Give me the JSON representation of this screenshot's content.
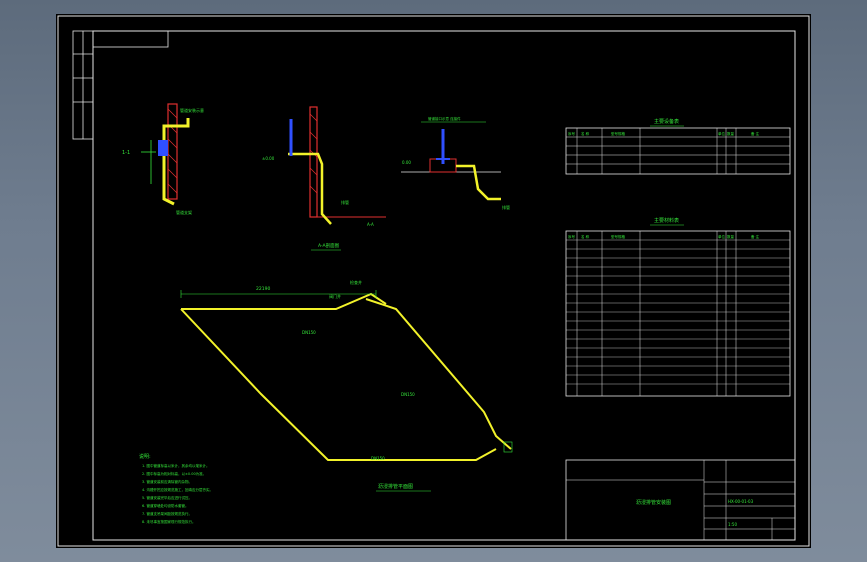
{
  "drawing": {
    "section_label": "1-1",
    "section_a_title": "A-A剖面图",
    "section_a_mark": "A-A",
    "plan_title": "沥浸排管平面图",
    "equipment_table_title": "主要设备表",
    "material_table_title": "主要材料表",
    "table_headers": [
      "序号",
      "名 称",
      "型号规格",
      "单位",
      "数量",
      "备 注"
    ],
    "notes_title": "说明:",
    "notes": [
      "1. 图中管道标高以米计，其余均以毫米计。",
      "2. 图中标高为相对标高，以±0.00为准。",
      "3. 管道安装前应清除管内杂物。",
      "4. 沟槽开挖应按规范施工，回填应分层夯实。",
      "5. 管道安装完毕后应进行试压。",
      "6. 管道穿墙处均设防水套管。",
      "7. 管道支吊架间距按规范执行。",
      "8. 未尽事宜按国家现行规范执行。"
    ],
    "dimension_total": "22190",
    "title_block": {
      "drawing_name": "沥浸排管安装图",
      "drawing_number": "HX-00-01-03",
      "scale": "1:50"
    },
    "colors": {
      "line_yellow": "#f2f22a",
      "text_green": "#35e63a",
      "frame_white": "#e6e6e6",
      "wall_red": "#e03030",
      "equipment_blue": "#3050ff"
    }
  }
}
